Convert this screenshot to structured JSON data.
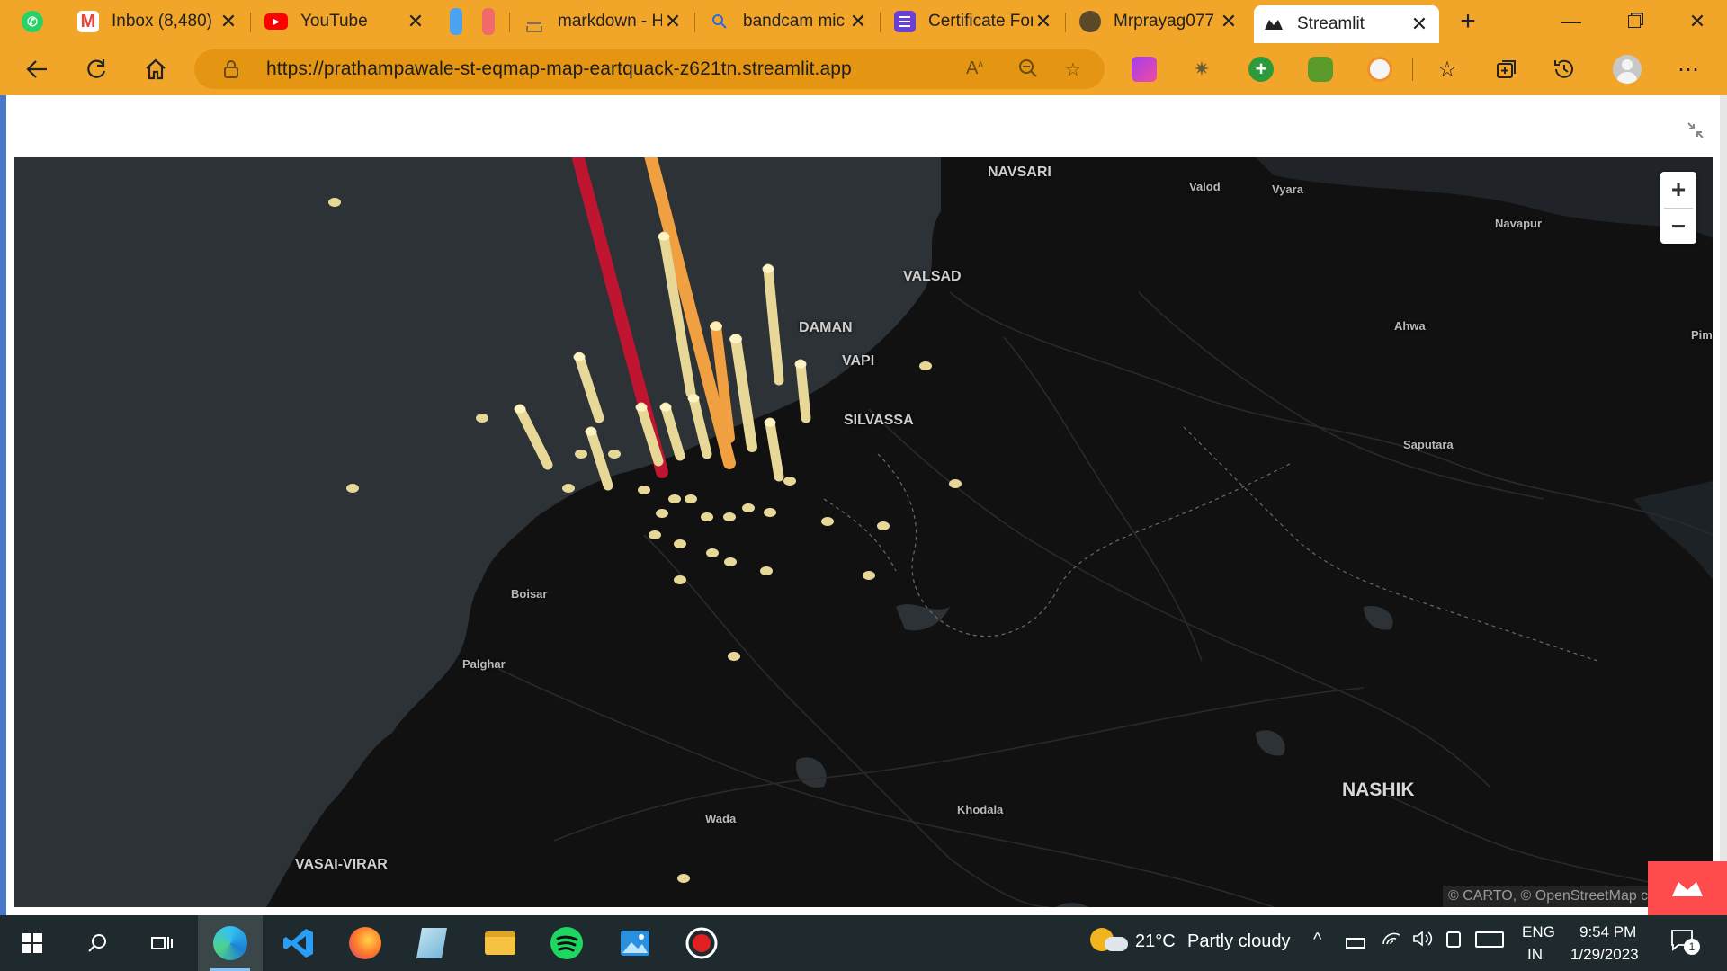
{
  "browser": {
    "tabs": [
      {
        "label": "",
        "icon": "whatsapp-icon",
        "color": "#25d366"
      },
      {
        "label": "Inbox (8,480)",
        "icon": "gmail-icon",
        "color": "#ea4335"
      },
      {
        "label": "YouTube",
        "icon": "youtube-icon",
        "color": "#ff0000"
      },
      {
        "label": "",
        "icon": "pinned-tab-blue-icon",
        "color": "#4aa3f0"
      },
      {
        "label": "",
        "icon": "pinned-tab-red-icon",
        "color": "#f06a6a"
      },
      {
        "label": "markdown - H",
        "icon": "stackoverflow-icon",
        "color": "#f48024"
      },
      {
        "label": "bandcam mic",
        "icon": "search-icon",
        "color": "#2b6cd8"
      },
      {
        "label": "Certificate For",
        "icon": "forms-icon",
        "color": "#6b3fd4"
      },
      {
        "label": "Mrprayag077",
        "icon": "github-icon",
        "color": "#222222"
      },
      {
        "label": "Streamlit",
        "icon": "streamlit-icon",
        "color": "#ff4b4b"
      }
    ],
    "new_tab_label": "+",
    "url": "https://prathampawale-st-eqmap-map-eartquack-z621tn.streamlit.app",
    "accent_color": "#f1a529"
  },
  "map": {
    "places": [
      {
        "name": "NAVSARI",
        "kind": "major"
      },
      {
        "name": "Valod",
        "kind": "minor"
      },
      {
        "name": "Vyara",
        "kind": "minor"
      },
      {
        "name": "Navapur",
        "kind": "minor"
      },
      {
        "name": "VALSAD",
        "kind": "major"
      },
      {
        "name": "DAMAN",
        "kind": "major"
      },
      {
        "name": "VAPI",
        "kind": "major"
      },
      {
        "name": "SILVASSA",
        "kind": "major"
      },
      {
        "name": "Ahwa",
        "kind": "minor"
      },
      {
        "name": "Pim",
        "kind": "minor"
      },
      {
        "name": "Saputara",
        "kind": "minor"
      },
      {
        "name": "Boisar",
        "kind": "minor"
      },
      {
        "name": "Palghar",
        "kind": "minor"
      },
      {
        "name": "Wada",
        "kind": "minor"
      },
      {
        "name": "Khodala",
        "kind": "minor"
      },
      {
        "name": "NASHIK",
        "kind": "big"
      },
      {
        "name": "VASAI-VIRAR",
        "kind": "major"
      }
    ],
    "zoom_in": "+",
    "zoom_out": "−",
    "attribution": "© CARTO, © OpenStreetMap co",
    "colors": {
      "land": "#111112",
      "sea": "#2d3237",
      "column_low": "#e8d898",
      "column_mid": "#f0a040",
      "column_high": "#c01530"
    }
  },
  "taskbar": {
    "weather_temp": "21°C",
    "weather_text": "Partly cloudy",
    "lang_top": "ENG",
    "lang_bottom": "IN",
    "time": "9:54 PM",
    "date": "1/29/2023",
    "notification_count": "1"
  }
}
